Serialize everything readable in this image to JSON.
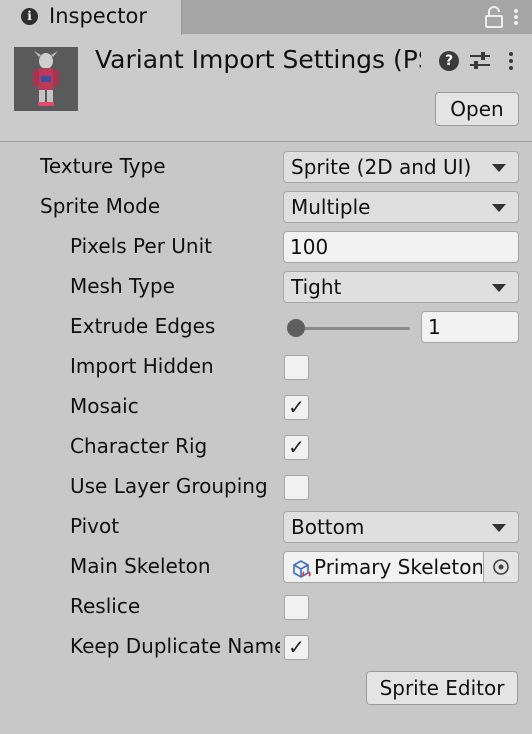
{
  "tab": {
    "label": "Inspector",
    "icon": "info-icon"
  },
  "header": {
    "title": "Variant Import Settings (PSB)",
    "open_label": "Open",
    "icons": [
      "help-icon",
      "preset-icon",
      "kebab-menu-icon"
    ]
  },
  "fields": {
    "texture_type": {
      "label": "Texture Type",
      "value": "Sprite (2D and UI)"
    },
    "sprite_mode": {
      "label": "Sprite Mode",
      "value": "Multiple"
    },
    "pixels_per_unit": {
      "label": "Pixels Per Unit",
      "value": "100"
    },
    "mesh_type": {
      "label": "Mesh Type",
      "value": "Tight"
    },
    "extrude_edges": {
      "label": "Extrude Edges",
      "value": "1",
      "slider_fraction": 0.03
    },
    "import_hidden": {
      "label": "Import Hidden",
      "checked": false,
      "mark": ""
    },
    "mosaic": {
      "label": "Mosaic",
      "checked": true,
      "mark": "✓"
    },
    "character_rig": {
      "label": "Character Rig",
      "checked": true,
      "mark": "✓"
    },
    "use_layer_grouping": {
      "label": "Use Layer Grouping",
      "checked": false,
      "mark": ""
    },
    "pivot": {
      "label": "Pivot",
      "value": "Bottom"
    },
    "main_skeleton": {
      "label": "Main Skeleton",
      "value": "Primary Skeleton"
    },
    "reslice": {
      "label": "Reslice",
      "checked": false,
      "mark": ""
    },
    "keep_duplicate_name": {
      "label": "Keep Duplicate Name",
      "checked": true,
      "mark": "✓"
    }
  },
  "sprite_editor_label": "Sprite Editor"
}
